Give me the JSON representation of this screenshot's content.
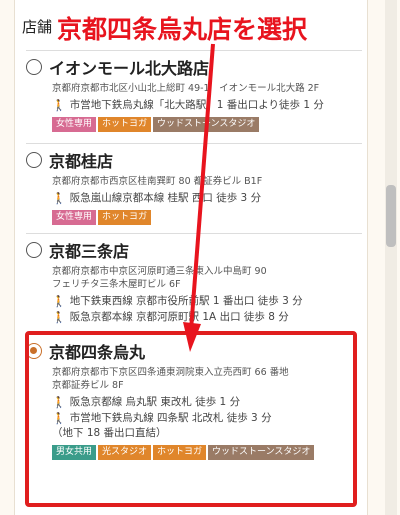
{
  "section": {
    "title": "店舗"
  },
  "annotation": {
    "text": "京都四条烏丸店を選択"
  },
  "stores": [
    {
      "name": "イオンモール北大路店",
      "address": "京都府京都市北区小山北上総町 49-1　イオンモール北大路 2F",
      "access": [
        "市営地下鉄烏丸線「北大路駅」1 番出口より徒歩 1 分"
      ],
      "tags": [
        {
          "label": "女性専用",
          "color": "#d76b92"
        },
        {
          "label": "ホットヨガ",
          "color": "#e0862b"
        },
        {
          "label": "ウッドストーンスタジオ",
          "color": "#9a7b66"
        }
      ]
    },
    {
      "name": "京都桂店",
      "address": "京都府京都市西京区桂南巽町 80 都証券ビル B1F",
      "access": [
        "阪急嵐山線京都本線 桂駅 西口 徒歩 3 分"
      ],
      "tags": [
        {
          "label": "女性専用",
          "color": "#d76b92"
        },
        {
          "label": "ホットヨガ",
          "color": "#e0862b"
        }
      ]
    },
    {
      "name": "京都三条店",
      "address_lines": [
        "京都府京都市中京区河原町通三条東入ル中島町 90",
        "フェリチタ三条木屋町ビル 6F"
      ],
      "access": [
        "地下鉄東西線 京都市役所前駅 1 番出口 徒歩 3 分",
        "阪急京都本線 京都河原町駅 1A 出口 徒歩 8 分"
      ],
      "tags": []
    },
    {
      "name": "京都四条烏丸",
      "address_lines": [
        "京都府京都市下京区四条通東洞院東入立売西町 66 番地",
        "京都証券ビル 8F"
      ],
      "access": [
        "阪急京都線 烏丸駅 東改札 徒歩 1 分",
        "市営地下鉄烏丸線 四条駅 北改札 徒歩 3 分"
      ],
      "access_note": "（地下 18 番出口直結）",
      "tags": [
        {
          "label": "男女共用",
          "color": "#3a9c8a"
        },
        {
          "label": "光スタジオ",
          "color": "#e0862b"
        },
        {
          "label": "ホットヨガ",
          "color": "#e0862b"
        },
        {
          "label": "ウッドストーンスタジオ",
          "color": "#9a7b66"
        }
      ]
    }
  ],
  "colors": {
    "accent_red": "#e01e1e",
    "radio_selected": "#c9702a"
  }
}
